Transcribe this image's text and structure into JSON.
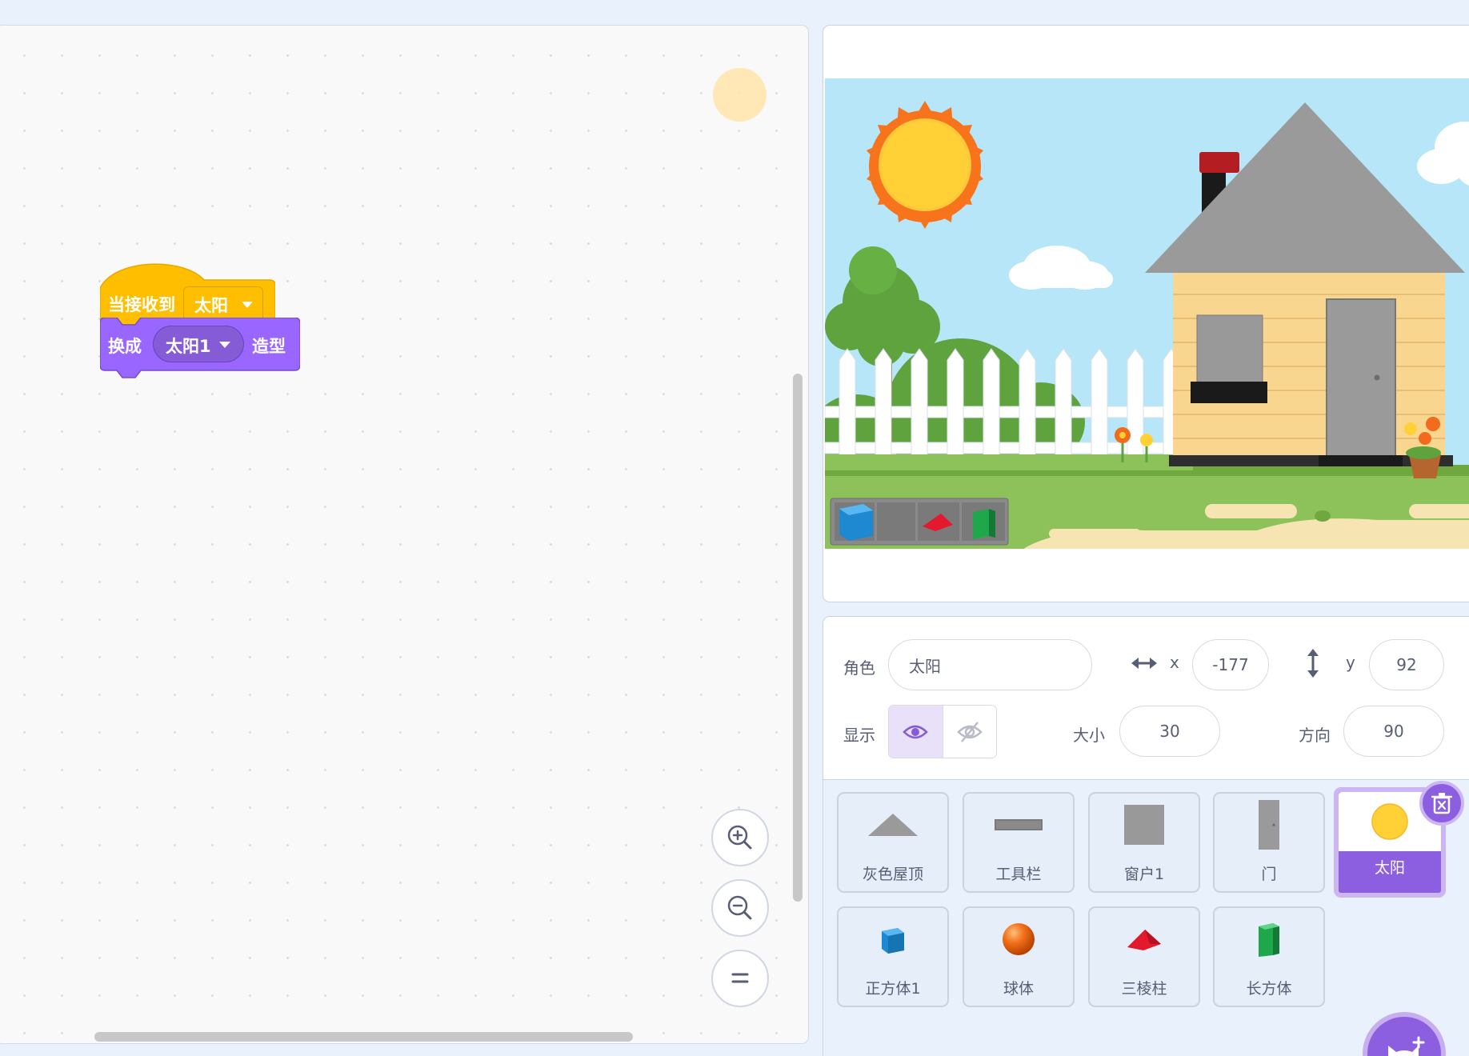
{
  "code": {
    "hat_block": {
      "label": "当接收到",
      "message": "太阳"
    },
    "costume_block": {
      "label_before": "换成",
      "costume": "太阳1",
      "label_after": "造型"
    },
    "zoom": {
      "in_icon": "zoom-in-icon",
      "out_icon": "zoom-out-icon",
      "reset_icon": "zoom-reset-icon"
    }
  },
  "colors": {
    "events_block": "#ffbf00",
    "looks_block": "#9966ff",
    "selection_accent": "#8c5ee0"
  },
  "sprite_info": {
    "sprite_label": "角色",
    "sprite_name": "太阳",
    "x_label": "x",
    "x_value": "-177",
    "y_label": "y",
    "y_value": "92",
    "show_label": "显示",
    "size_label": "大小",
    "size_value": "30",
    "direction_label": "方向",
    "direction_value": "90",
    "visible": true
  },
  "sprites": [
    {
      "name": "灰色屋顶",
      "icon": "gray-roof-icon",
      "selected": false
    },
    {
      "name": "工具栏",
      "icon": "toolbar-icon",
      "selected": false
    },
    {
      "name": "窗户1",
      "icon": "window-icon",
      "selected": false
    },
    {
      "name": "门",
      "icon": "door-icon",
      "selected": false
    },
    {
      "name": "太阳",
      "icon": "sun-icon",
      "selected": true
    },
    {
      "name": "正方体1",
      "icon": "cube-icon",
      "selected": false
    },
    {
      "name": "球体",
      "icon": "sphere-icon",
      "selected": false
    },
    {
      "name": "三棱柱",
      "icon": "prism-icon",
      "selected": false
    },
    {
      "name": "长方体",
      "icon": "cuboid-icon",
      "selected": false
    }
  ]
}
